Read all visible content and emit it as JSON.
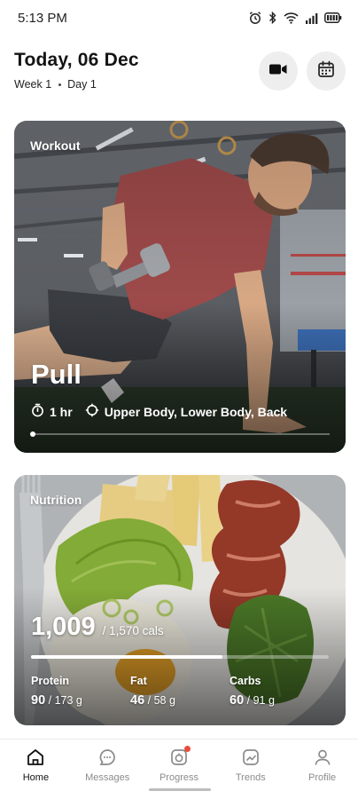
{
  "status_bar": {
    "time": "5:13 PM",
    "icons": [
      "alarm-icon",
      "bluetooth-icon",
      "wifi-icon",
      "signal-icon",
      "battery-icon"
    ]
  },
  "header": {
    "title": "Today, 06 Dec",
    "week": "Week 1",
    "day": "Day 1",
    "buttons": [
      "video-icon",
      "calendar-icon"
    ]
  },
  "workout": {
    "label": "Workout",
    "name": "Pull",
    "duration": "1 hr",
    "muscles": "Upper Body, Lower Body, Back"
  },
  "nutrition": {
    "label": "Nutrition",
    "calories": "1,009",
    "calories_total": "/ 1,570 cals",
    "progress": 0.643,
    "macros": [
      {
        "label": "Protein",
        "value": "90",
        "total": "/ 173 g"
      },
      {
        "label": "Fat",
        "value": "46",
        "total": "/ 58 g"
      },
      {
        "label": "Carbs",
        "value": "60",
        "total": "/ 91 g"
      }
    ]
  },
  "nav": {
    "items": [
      {
        "label": "Home",
        "icon": "home-icon",
        "active": true
      },
      {
        "label": "Messages",
        "icon": "messages-icon",
        "active": false
      },
      {
        "label": "Progress",
        "icon": "progress-icon",
        "active": false,
        "badge": true
      },
      {
        "label": "Trends",
        "icon": "trends-icon",
        "active": false
      },
      {
        "label": "Profile",
        "icon": "profile-icon",
        "active": false
      }
    ]
  },
  "colors": {
    "accent": "#e84c3d",
    "nav_inactive": "#8b8b8b"
  }
}
